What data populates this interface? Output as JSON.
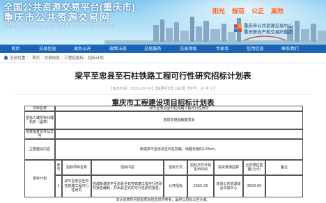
{
  "header": {
    "title_line1": "全国公共资源交易平台(重庆市)",
    "title_line2": "重庆市公共资源交易网",
    "title_en": "CHONG QING PUBLIC RESOURCES TRADING CENTER",
    "slogans": [
      "阳光",
      "规范",
      "公正",
      "高效"
    ],
    "orgs": [
      "重庆市公共资源交易中心",
      "重庆联合产权交易所集团"
    ]
  },
  "nav": {
    "items": [
      "首页",
      "交易信息",
      "政务公开",
      "政策法规",
      "交易服务",
      "交易指南",
      "专家库",
      "信用信息",
      "联系我们"
    ]
  },
  "breadcrumb": {
    "items": [
      "当前位置",
      "首页",
      "交易信息",
      "工程招投标",
      "招标计划"
    ]
  },
  "article": {
    "title": "梁平至忠县至石柱铁路工程可行性研究招标计划表",
    "meta": "【信息时间：2025-05-14】【我要打印】【关闭】【字号：大 中 小】",
    "table_title": "重庆市工程建设项目招标计划表"
  },
  "table": {
    "project_name_label": "项目名称",
    "project_name": "梁平至忠县至石柱铁路工程可行性研究",
    "tenderer_label": "招标人或招标代理机构（盖章）",
    "tenderer": "忠县交通运输委员会",
    "approval_label": "项目批复文件及文号",
    "approval": "",
    "content_label": "主要建设内容",
    "content": "新建梁平至忠县至石柱铁路，线路长度约120km。",
    "plan_label": "招标计划",
    "col_headers": [
      "序号",
      "招标项目名称",
      "招标内容",
      "招标方式",
      "招标文件计划发布时间",
      "投资费用估算",
      "合同预估金额(万元)",
      "备注"
    ],
    "rows": [
      {
        "no": "1",
        "name": "梁平至忠县至石柱铁路工程可行性研究",
        "content": "完成新建梁平至忠县至石柱铁路工程可行性研究报告编制，并出具正式的可行性研究报告。",
        "method": "公开招标",
        "time": "2025-05",
        "invest": "忠县公共资源综合交易中心",
        "amount": "3500.00",
        "note": ""
      }
    ]
  },
  "footer_note": "本计划表所列招标项目信息仅供参考，最终以招标公告为准。"
}
